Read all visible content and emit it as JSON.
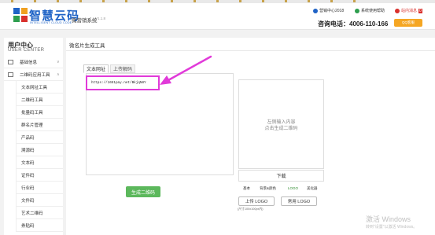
{
  "header": {
    "brand_title": "智慧云码",
    "brand_subtitle": "INTELLIGENT CLOUD CODE",
    "system_name": "微营销系统",
    "version": "V1.1.8",
    "account_label": "营销中心2018",
    "help_label": "系统使用帮助",
    "message_label": "站内消息",
    "message_count": "0",
    "phone": "咨询电话：4006-110-166",
    "qq_label": "QQ客服"
  },
  "sidebar": {
    "title": "用户中心",
    "subtitle": "USER CENTER",
    "groups": [
      {
        "label": "基础信息",
        "chevron": "∨"
      },
      {
        "label": "二维码应用工具",
        "chevron": "∧"
      }
    ],
    "items": [
      "文本网址工具",
      "二维码工具",
      "批量码工具",
      "群名片管理",
      "产品码",
      "溯源码",
      "文本码",
      "证件码",
      "行业码",
      "文件码",
      "艺术二维码",
      "券贴码"
    ]
  },
  "main": {
    "panel_title": "微名片生成工具",
    "tabs": [
      "文本网址",
      "上传解码"
    ],
    "url_value": "https://1651pay.net/BkjqN8Y",
    "preview_text": [
      "左侧输入内容",
      "点击生成二维码"
    ],
    "download_label": "下载",
    "options": [
      "基本",
      "背景&颜色",
      "LOGO",
      "美化器"
    ],
    "upload_logo_label": "上传 LOGO",
    "common_logo_label": "常用 LOGO",
    "upload_hint": "(尺寸100x100px内)",
    "generate_label": "生成二维码"
  },
  "watermark": {
    "line1": "激活 Windows",
    "line2": "转到\"设置\"以激活 Windows。"
  },
  "colors": {
    "brand_blue": "#1f63c6",
    "highlight_magenta": "#e13ad9",
    "generate_green": "#5cb85c",
    "qq_orange": "#f5a623"
  }
}
